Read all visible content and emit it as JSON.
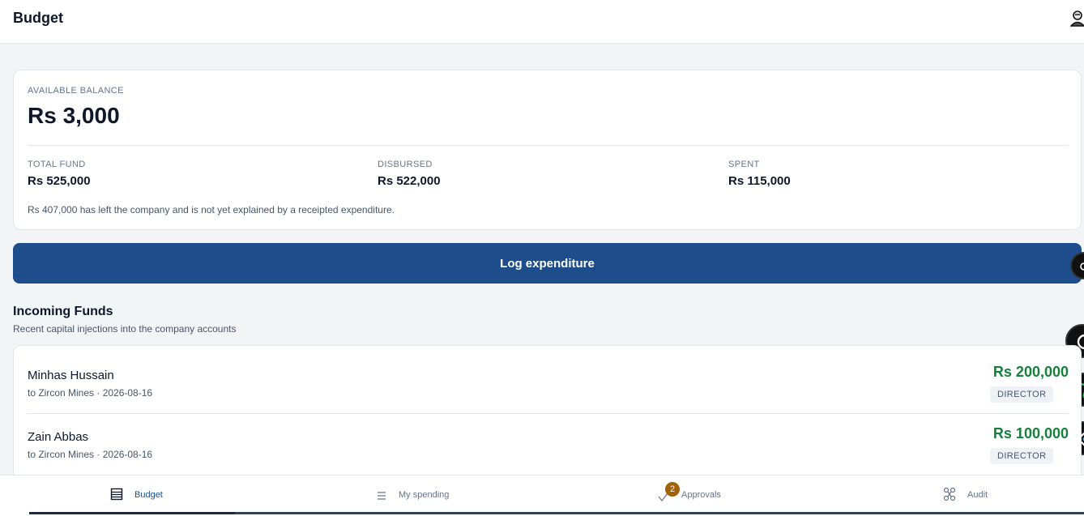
{
  "header": {
    "title": "Budget",
    "profile_icon": "user-icon"
  },
  "balance": {
    "label": "AVAILABLE BALANCE",
    "value": "Rs 3,000",
    "stats": [
      {
        "label": "TOTAL FUND",
        "value": "Rs 525,000"
      },
      {
        "label": "DISBURSED",
        "value": "Rs 522,000"
      },
      {
        "label": "SPENT",
        "value": "Rs 115,000"
      }
    ],
    "note": "Rs 407,000 has left the company and is not yet explained by a receipted expenditure."
  },
  "actions": {
    "log_label": "Log expenditure"
  },
  "incoming": {
    "title": "Incoming Funds",
    "subtitle": "Recent capital injections into the company accounts",
    "rows": [
      {
        "name": "Minhas Hussain",
        "meta": "to Zircon Mines · 2026-08-16",
        "amount": "Rs 200,000",
        "role": "DIRECTOR"
      },
      {
        "name": "Zain Abbas",
        "meta": "to Zircon Mines · 2026-08-16",
        "amount": "Rs 100,000",
        "role": "DIRECTOR"
      }
    ]
  },
  "nav": {
    "items": [
      {
        "label": "Budget",
        "icon": "ledger-icon"
      },
      {
        "label": "My spending",
        "icon": "list-icon"
      },
      {
        "label": "Approvals",
        "icon": "check-icon",
        "badge": "2"
      },
      {
        "label": "Audit",
        "icon": "audit-icon"
      }
    ]
  },
  "colors": {
    "primary": "#1e4d8c",
    "positive": "#15803d",
    "badge": "#a16207"
  }
}
